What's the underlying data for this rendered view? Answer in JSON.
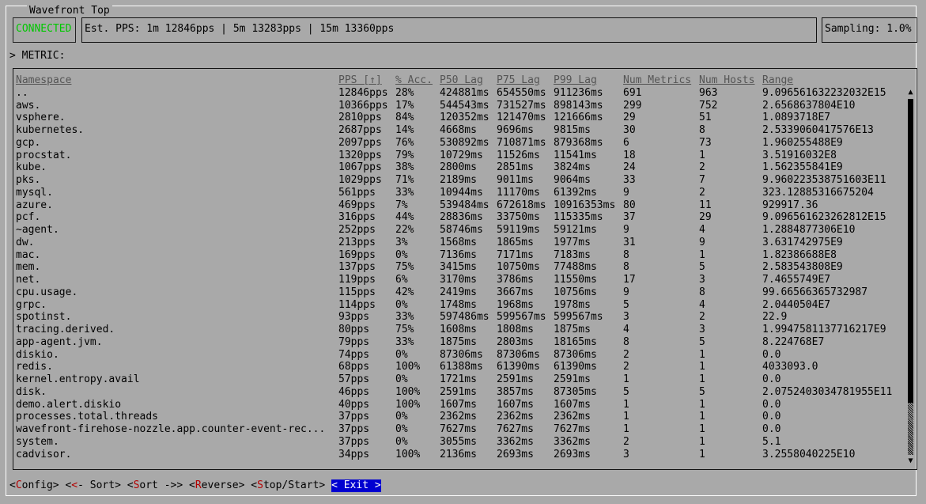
{
  "app": {
    "title": "Wavefront Top"
  },
  "status": {
    "connection": "CONNECTED",
    "pps_summary": "Est. PPS: 1m 12846pps | 5m 13283pps | 15m 13360pps",
    "sampling": "Sampling: 1.0%"
  },
  "prompt": "> METRIC:",
  "table": {
    "headers": [
      "Namespace",
      "PPS [↑]",
      "% Acc.",
      "P50 Lag",
      "P75 Lag",
      "P99 Lag",
      "Num Metrics",
      "Num Hosts",
      "Range"
    ],
    "rows": [
      [
        "..",
        "12846pps",
        "28%",
        "424881ms",
        "654550ms",
        "911236ms",
        "691",
        "963",
        "9.096561632232032E15"
      ],
      [
        "aws.",
        "10366pps",
        "17%",
        "544543ms",
        "731527ms",
        "898143ms",
        "299",
        "752",
        "2.6568637804E10"
      ],
      [
        "vsphere.",
        "2810pps",
        "84%",
        "120352ms",
        "121470ms",
        "121666ms",
        "29",
        "51",
        "1.0893718E7"
      ],
      [
        "kubernetes.",
        "2687pps",
        "14%",
        "4668ms",
        "9696ms",
        "9815ms",
        "30",
        "8",
        "2.5339060417576E13"
      ],
      [
        "gcp.",
        "2097pps",
        "76%",
        "530892ms",
        "710871ms",
        "879368ms",
        "6",
        "73",
        "1.960255488E9"
      ],
      [
        "procstat.",
        "1320pps",
        "79%",
        "10729ms",
        "11526ms",
        "11541ms",
        "18",
        "1",
        "3.51916032E8"
      ],
      [
        "kube.",
        "1067pps",
        "38%",
        "2800ms",
        "2851ms",
        "3824ms",
        "24",
        "2",
        "1.562355841E9"
      ],
      [
        "pks.",
        "1029pps",
        "71%",
        "2189ms",
        "9011ms",
        "9064ms",
        "33",
        "7",
        "9.960223538751603E11"
      ],
      [
        "mysql.",
        "561pps",
        "33%",
        "10944ms",
        "11170ms",
        "61392ms",
        "9",
        "2",
        "323.12885316675204"
      ],
      [
        "azure.",
        "469pps",
        "7%",
        "539484ms",
        "672618ms",
        "10916353ms",
        "80",
        "11",
        "929917.36"
      ],
      [
        "pcf.",
        "316pps",
        "44%",
        "28836ms",
        "33750ms",
        "115335ms",
        "37",
        "29",
        "9.096561623262812E15"
      ],
      [
        "~agent.",
        "252pps",
        "22%",
        "58746ms",
        "59119ms",
        "59121ms",
        "9",
        "4",
        "1.2884877306E10"
      ],
      [
        "dw.",
        "213pps",
        "3%",
        "1568ms",
        "1865ms",
        "1977ms",
        "31",
        "9",
        "3.631742975E9"
      ],
      [
        "mac.",
        "169pps",
        "0%",
        "7136ms",
        "7171ms",
        "7183ms",
        "8",
        "1",
        "1.82386688E8"
      ],
      [
        "mem.",
        "137pps",
        "75%",
        "3415ms",
        "10750ms",
        "77488ms",
        "8",
        "5",
        "2.583543808E9"
      ],
      [
        "net.",
        "119pps",
        "6%",
        "3170ms",
        "3786ms",
        "11550ms",
        "17",
        "3",
        "7.4655749E7"
      ],
      [
        "cpu.usage.",
        "115pps",
        "42%",
        "2419ms",
        "3667ms",
        "10756ms",
        "9",
        "8",
        "99.66566365732987"
      ],
      [
        "grpc.",
        "114pps",
        "0%",
        "1748ms",
        "1968ms",
        "1978ms",
        "5",
        "4",
        "2.0440504E7"
      ],
      [
        "spotinst.",
        "93pps",
        "33%",
        "597486ms",
        "599567ms",
        "599567ms",
        "3",
        "2",
        "22.9"
      ],
      [
        "tracing.derived.",
        "80pps",
        "75%",
        "1608ms",
        "1808ms",
        "1875ms",
        "4",
        "3",
        "1.9947581137716217E9"
      ],
      [
        "app-agent.jvm.",
        "79pps",
        "33%",
        "1875ms",
        "2803ms",
        "18165ms",
        "8",
        "5",
        "8.224768E7"
      ],
      [
        "diskio.",
        "74pps",
        "0%",
        "87306ms",
        "87306ms",
        "87306ms",
        "2",
        "1",
        "0.0"
      ],
      [
        "redis.",
        "68pps",
        "100%",
        "61388ms",
        "61390ms",
        "61390ms",
        "2",
        "1",
        "4033093.0"
      ],
      [
        "kernel.entropy.avail",
        "57pps",
        "0%",
        "1721ms",
        "2591ms",
        "2591ms",
        "1",
        "1",
        "0.0"
      ],
      [
        "disk.",
        "46pps",
        "100%",
        "2591ms",
        "3857ms",
        "87305ms",
        "5",
        "5",
        "2.0752403034781955E11"
      ],
      [
        "demo.alert.diskio",
        "40pps",
        "100%",
        "1607ms",
        "1607ms",
        "1607ms",
        "1",
        "1",
        "0.0"
      ],
      [
        "processes.total.threads",
        "37pps",
        "0%",
        "2362ms",
        "2362ms",
        "2362ms",
        "1",
        "1",
        "0.0"
      ],
      [
        "wavefront-firehose-nozzle.app.counter-event-rec...",
        "37pps",
        "0%",
        "7627ms",
        "7627ms",
        "7627ms",
        "1",
        "1",
        "0.0"
      ],
      [
        "system.",
        "37pps",
        "0%",
        "3055ms",
        "3362ms",
        "3362ms",
        "2",
        "1",
        "5.1"
      ],
      [
        "cadvisor.",
        "34pps",
        "100%",
        "2136ms",
        "2693ms",
        "2693ms",
        "3",
        "1",
        "3.2558040225E10"
      ]
    ]
  },
  "footer": {
    "config": {
      "open": "<",
      "hot": "C",
      "rest": "onfig>"
    },
    "sort_left": {
      "open": "<",
      "hot": "<",
      "rest": "- Sort>"
    },
    "sort_right": {
      "open": "<",
      "hot": "S",
      "rest": "ort ->>"
    },
    "reverse": {
      "open": "<",
      "hot": "R",
      "rest": "everse>"
    },
    "stop_start": {
      "open": "<",
      "hot": "S",
      "rest": "top/Start>"
    },
    "exit": {
      "open": "< ",
      "hot": "E",
      "rest": "xit >"
    }
  },
  "icons": {
    "scroll_up": "▲",
    "scroll_down": "▼"
  },
  "colors": {
    "background": "#a9a9a9",
    "connected": "#00c800",
    "hotkey": "#b30000",
    "exit_bg": "#0000d0"
  }
}
